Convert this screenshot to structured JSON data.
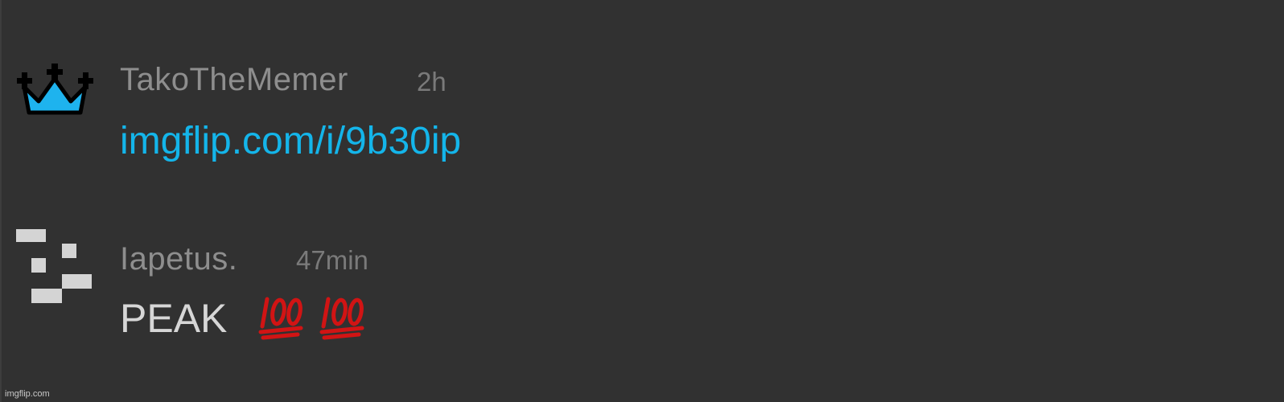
{
  "comments": [
    {
      "avatar_icon": "crown-icon",
      "username": "TakoTheMemer",
      "timestamp": "2h",
      "message_link": "imgflip.com/i/9b30ip"
    },
    {
      "avatar_icon": "pixel-blocks-icon",
      "username": "Iapetus.",
      "timestamp": "47min",
      "message_text": "PEAK",
      "emojis": [
        "hundred-points-icon",
        "hundred-points-icon"
      ]
    }
  ],
  "watermark": "imgflip.com",
  "colors": {
    "background": "#313131",
    "link": "#14b5ea",
    "username": "#8e8e8e",
    "timestamp": "#7a7a7a",
    "message": "#d6d6d6",
    "crown": "#1eb3ee",
    "hundred": "#d11414"
  }
}
